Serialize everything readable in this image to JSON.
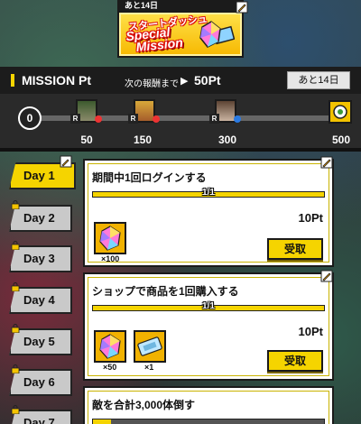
{
  "banner": {
    "days_left": "あと14日",
    "title_jp": "スタートダッシュ",
    "title_line1": "Special",
    "title_line2": "Mission"
  },
  "mission": {
    "title": "MISSION Pt",
    "next_label": "次の報酬まで",
    "next_pt": "50Pt",
    "days_left_button": "あと14日",
    "current_points": "0",
    "progress_fraction": 0.0,
    "milestones": [
      "50",
      "150",
      "300",
      "500"
    ]
  },
  "days": [
    {
      "label": "Day 1",
      "active": true,
      "locked": false
    },
    {
      "label": "Day 2",
      "active": false,
      "locked": true
    },
    {
      "label": "Day 3",
      "active": false,
      "locked": true
    },
    {
      "label": "Day 4",
      "active": false,
      "locked": true
    },
    {
      "label": "Day 5",
      "active": false,
      "locked": true
    },
    {
      "label": "Day 6",
      "active": false,
      "locked": true
    },
    {
      "label": "Day 7",
      "active": false,
      "locked": true
    }
  ],
  "cards": [
    {
      "title": "期間中1回ログインする",
      "progress_text": "1/1",
      "progress_fraction": 1.0,
      "points": "10Pt",
      "rewards": [
        {
          "icon": "crystal-gem-icon",
          "count": "×100"
        }
      ],
      "button": "受取"
    },
    {
      "title": "ショップで商品を1回購入する",
      "progress_text": "1/1",
      "progress_fraction": 1.0,
      "points": "10Pt",
      "rewards": [
        {
          "icon": "crystal-gem-icon",
          "count": "×50"
        },
        {
          "icon": "ticket-icon",
          "count": "×1"
        }
      ],
      "button": "受取"
    },
    {
      "title": "敵を合計3,000体倒す",
      "progress_text": "",
      "progress_fraction": 0.08
    }
  ]
}
